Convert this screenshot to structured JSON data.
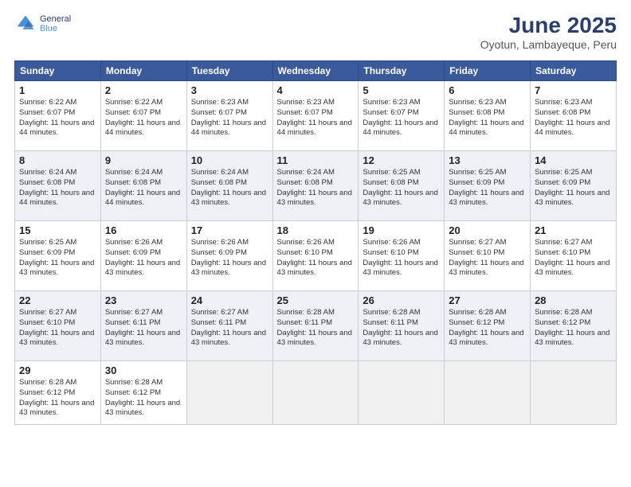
{
  "header": {
    "logo_general": "General",
    "logo_blue": "Blue",
    "month_title": "June 2025",
    "location": "Oyotun, Lambayeque, Peru"
  },
  "weekdays": [
    "Sunday",
    "Monday",
    "Tuesday",
    "Wednesday",
    "Thursday",
    "Friday",
    "Saturday"
  ],
  "weeks": [
    [
      {
        "day": "1",
        "sunrise": "6:22 AM",
        "sunset": "6:07 PM",
        "daylight": "11 hours and 44 minutes."
      },
      {
        "day": "2",
        "sunrise": "6:22 AM",
        "sunset": "6:07 PM",
        "daylight": "11 hours and 44 minutes."
      },
      {
        "day": "3",
        "sunrise": "6:23 AM",
        "sunset": "6:07 PM",
        "daylight": "11 hours and 44 minutes."
      },
      {
        "day": "4",
        "sunrise": "6:23 AM",
        "sunset": "6:07 PM",
        "daylight": "11 hours and 44 minutes."
      },
      {
        "day": "5",
        "sunrise": "6:23 AM",
        "sunset": "6:07 PM",
        "daylight": "11 hours and 44 minutes."
      },
      {
        "day": "6",
        "sunrise": "6:23 AM",
        "sunset": "6:08 PM",
        "daylight": "11 hours and 44 minutes."
      },
      {
        "day": "7",
        "sunrise": "6:23 AM",
        "sunset": "6:08 PM",
        "daylight": "11 hours and 44 minutes."
      }
    ],
    [
      {
        "day": "8",
        "sunrise": "6:24 AM",
        "sunset": "6:08 PM",
        "daylight": "11 hours and 44 minutes."
      },
      {
        "day": "9",
        "sunrise": "6:24 AM",
        "sunset": "6:08 PM",
        "daylight": "11 hours and 44 minutes."
      },
      {
        "day": "10",
        "sunrise": "6:24 AM",
        "sunset": "6:08 PM",
        "daylight": "11 hours and 43 minutes."
      },
      {
        "day": "11",
        "sunrise": "6:24 AM",
        "sunset": "6:08 PM",
        "daylight": "11 hours and 43 minutes."
      },
      {
        "day": "12",
        "sunrise": "6:25 AM",
        "sunset": "6:08 PM",
        "daylight": "11 hours and 43 minutes."
      },
      {
        "day": "13",
        "sunrise": "6:25 AM",
        "sunset": "6:09 PM",
        "daylight": "11 hours and 43 minutes."
      },
      {
        "day": "14",
        "sunrise": "6:25 AM",
        "sunset": "6:09 PM",
        "daylight": "11 hours and 43 minutes."
      }
    ],
    [
      {
        "day": "15",
        "sunrise": "6:25 AM",
        "sunset": "6:09 PM",
        "daylight": "11 hours and 43 minutes."
      },
      {
        "day": "16",
        "sunrise": "6:26 AM",
        "sunset": "6:09 PM",
        "daylight": "11 hours and 43 minutes."
      },
      {
        "day": "17",
        "sunrise": "6:26 AM",
        "sunset": "6:09 PM",
        "daylight": "11 hours and 43 minutes."
      },
      {
        "day": "18",
        "sunrise": "6:26 AM",
        "sunset": "6:10 PM",
        "daylight": "11 hours and 43 minutes."
      },
      {
        "day": "19",
        "sunrise": "6:26 AM",
        "sunset": "6:10 PM",
        "daylight": "11 hours and 43 minutes."
      },
      {
        "day": "20",
        "sunrise": "6:27 AM",
        "sunset": "6:10 PM",
        "daylight": "11 hours and 43 minutes."
      },
      {
        "day": "21",
        "sunrise": "6:27 AM",
        "sunset": "6:10 PM",
        "daylight": "11 hours and 43 minutes."
      }
    ],
    [
      {
        "day": "22",
        "sunrise": "6:27 AM",
        "sunset": "6:10 PM",
        "daylight": "11 hours and 43 minutes."
      },
      {
        "day": "23",
        "sunrise": "6:27 AM",
        "sunset": "6:11 PM",
        "daylight": "11 hours and 43 minutes."
      },
      {
        "day": "24",
        "sunrise": "6:27 AM",
        "sunset": "6:11 PM",
        "daylight": "11 hours and 43 minutes."
      },
      {
        "day": "25",
        "sunrise": "6:28 AM",
        "sunset": "6:11 PM",
        "daylight": "11 hours and 43 minutes."
      },
      {
        "day": "26",
        "sunrise": "6:28 AM",
        "sunset": "6:11 PM",
        "daylight": "11 hours and 43 minutes."
      },
      {
        "day": "27",
        "sunrise": "6:28 AM",
        "sunset": "6:12 PM",
        "daylight": "11 hours and 43 minutes."
      },
      {
        "day": "28",
        "sunrise": "6:28 AM",
        "sunset": "6:12 PM",
        "daylight": "11 hours and 43 minutes."
      }
    ],
    [
      {
        "day": "29",
        "sunrise": "6:28 AM",
        "sunset": "6:12 PM",
        "daylight": "11 hours and 43 minutes."
      },
      {
        "day": "30",
        "sunrise": "6:28 AM",
        "sunset": "6:12 PM",
        "daylight": "11 hours and 43 minutes."
      },
      null,
      null,
      null,
      null,
      null
    ]
  ],
  "labels": {
    "sunrise": "Sunrise:",
    "sunset": "Sunset:",
    "daylight": "Daylight:"
  }
}
